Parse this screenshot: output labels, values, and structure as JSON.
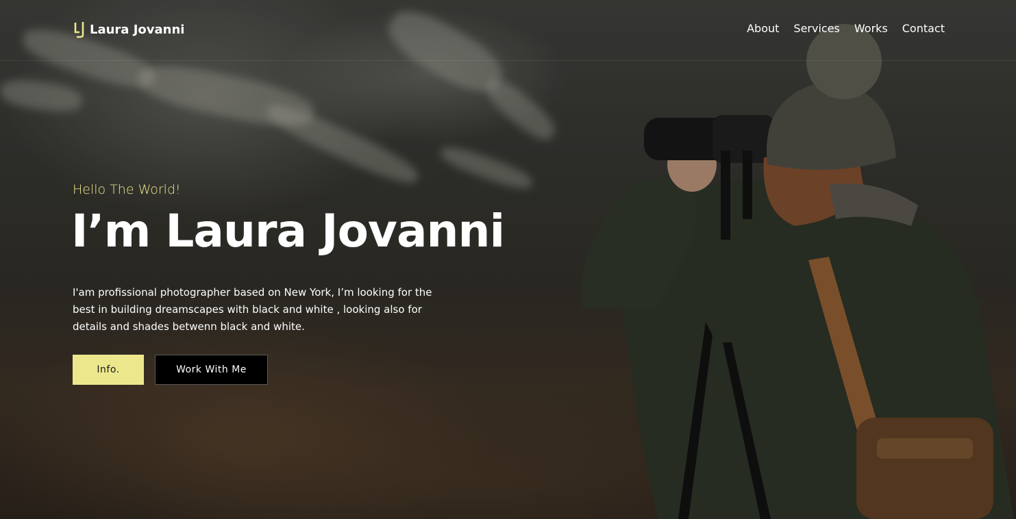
{
  "header": {
    "logo_text": "Laura Jovanni",
    "nav": [
      {
        "label": "About"
      },
      {
        "label": "Services"
      },
      {
        "label": "Works"
      },
      {
        "label": "Contact"
      }
    ]
  },
  "hero": {
    "greeting": "Hello The World!",
    "headline": "I’m Laura Jovanni",
    "bio": "I'am profissional photographer based on New York, I’m looking for the best in building dreamscapes with black and white , looking also for details and shades betwenn black and white.",
    "buttons": {
      "info_label": "Info.",
      "work_label": "Work With Me"
    },
    "background_icon": "photographer-with-binoculars-image"
  },
  "colors": {
    "accent": "#ece78c",
    "text": "#ffffff",
    "button_dark": "#000000"
  }
}
